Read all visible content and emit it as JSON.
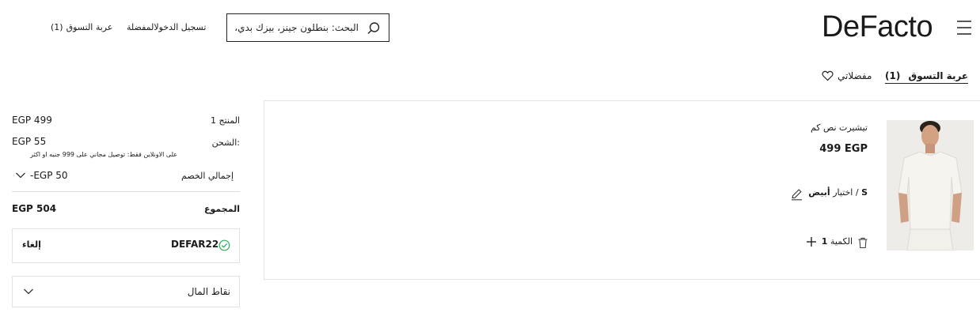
{
  "header": {
    "logo": "DeFacto",
    "search_placeholder": "البحث: بنطلون جينز، بيزك بدي، د",
    "cart_link": "عربة التسوق",
    "cart_count": "(1)",
    "login_fav_link": "تسجيل الدخولالمفضلة"
  },
  "tabs": {
    "cart_label": "عربة التسوق",
    "cart_count": "(1)",
    "favorites_label": "مفضلاتي"
  },
  "product": {
    "name": "تيشيرت نص كم",
    "price": "499 EGP",
    "size": "S",
    "variant_sep": " / ",
    "variant_prefix": "اختيار ",
    "color": "أبيض",
    "quantity_label": "الكمية",
    "quantity": "1"
  },
  "summary": {
    "product_label": "المنتج 1",
    "product_value": "EGP 499",
    "shipping_label": ":الشحن",
    "shipping_value": "EGP 55",
    "shipping_note": "على الاونلاين فقط: توصيل مجاني على 999 جنيه او اكثر",
    "discount_label": "إجمالي الخصم",
    "discount_value": "-EGP 50",
    "total_label": "المجموع",
    "total_value": "EGP 504",
    "coupon_code": "DEFAR22",
    "coupon_cancel": "إلغاء",
    "points_label": "نقاط المال"
  },
  "colors": {
    "text": "#1a1a1a",
    "border": "#e2e2e2",
    "success": "#2fae5c"
  },
  "icons": [
    "menu-icon",
    "search-icon",
    "heart-icon",
    "edit-icon",
    "trash-icon",
    "plus-icon",
    "chevron-down-icon",
    "check-circle-icon"
  ]
}
